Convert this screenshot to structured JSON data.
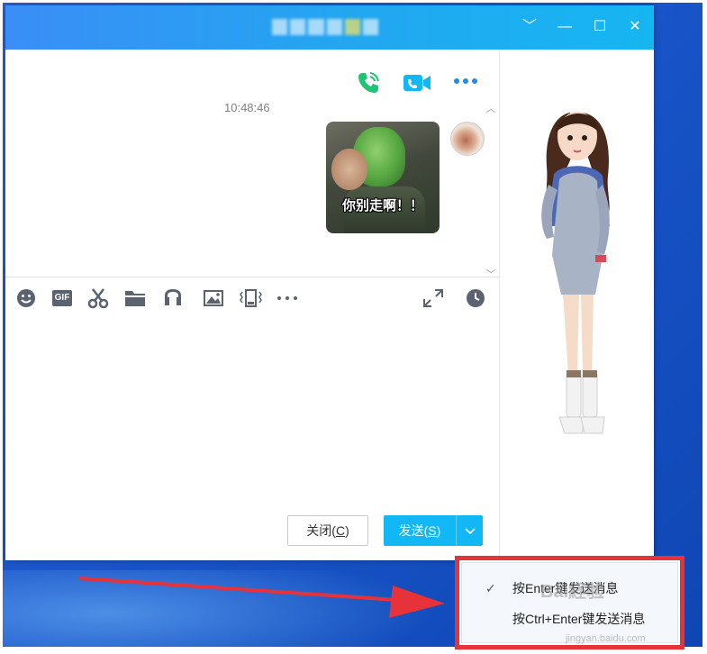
{
  "window": {
    "controls": {
      "dropdown": "﹀",
      "minimize": "—",
      "maximize": "☐",
      "close": "✕"
    }
  },
  "chat": {
    "timestamp": "10:48:46",
    "sticker_caption": "你别走啊！！",
    "header_actions": [
      "phone-call-icon",
      "video-call-icon",
      "more-options-icon"
    ]
  },
  "toolbar": {
    "items": [
      "emoji-icon",
      "gif-icon",
      "scissors-screenshot-icon",
      "folder-icon",
      "music-icon",
      "image-icon",
      "shake-window-icon",
      "more-tools-icon"
    ],
    "gif_label": "GIF",
    "right_items": [
      "expand-icon",
      "history-clock-icon"
    ]
  },
  "buttons": {
    "close_label": "关闭(",
    "close_hotkey": "C",
    "close_suffix": ")",
    "send_label": "发送(",
    "send_hotkey": "S",
    "send_suffix": ")"
  },
  "send_menu": {
    "items": [
      {
        "label": "按Enter键发送消息",
        "checked": true
      },
      {
        "label": "按Ctrl+Enter键发送消息",
        "checked": false
      }
    ],
    "check_mark": "✓"
  },
  "watermark": {
    "brand": "Bai経验",
    "url": "jingyan.baidu.com"
  },
  "colors": {
    "titlebar_start": "#3a8ef6",
    "titlebar_end": "#16b6f2",
    "send_button": "#12b7f5",
    "annotation_red": "#e8323a",
    "call_green": "#1fc574",
    "video_blue": "#12b7f5"
  }
}
